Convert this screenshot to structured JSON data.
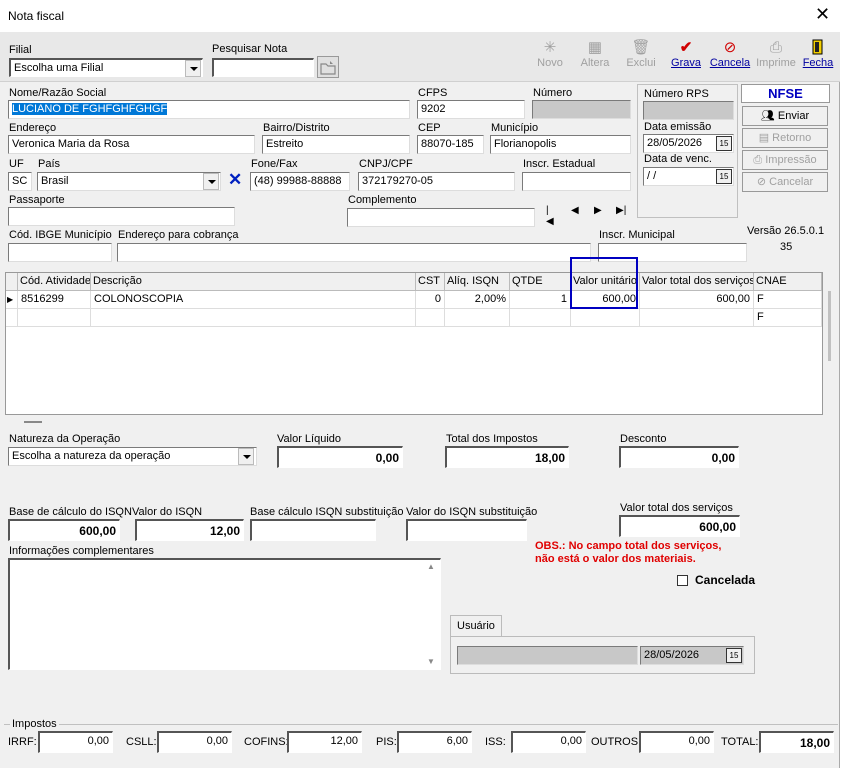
{
  "window": {
    "title": "Nota fiscal",
    "close": "✕"
  },
  "toolbar": {
    "filial_label": "Filial",
    "filial_value": "Escolha uma Filial",
    "pesquisar_label": "Pesquisar Nota",
    "pesquisar_value": "",
    "buttons": [
      {
        "label": "Novo",
        "icon": "new-icon",
        "enabled": false
      },
      {
        "label": "Altera",
        "icon": "edit-icon",
        "enabled": false
      },
      {
        "label": "Exclui",
        "icon": "trash-icon",
        "enabled": false
      },
      {
        "label": "Grava",
        "icon": "check-icon",
        "enabled": true
      },
      {
        "label": "Cancela",
        "icon": "cancel-icon",
        "enabled": true
      },
      {
        "label": "Imprime",
        "icon": "printer-icon",
        "enabled": false
      },
      {
        "label": "Fecha",
        "icon": "exit-door-icon",
        "enabled": true
      }
    ]
  },
  "form": {
    "nome_label": "Nome/Razão Social",
    "nome_value": "LUCIANO DE FGHFGHFGHGF",
    "cfps_label": "CFPS",
    "cfps_value": "9202",
    "numero_label": "Número",
    "numero_value": "",
    "endereco_label": "Endereço",
    "endereco_value": "Veronica Maria da Rosa",
    "bairro_label": "Bairro/Distrito",
    "bairro_value": "Estreito",
    "cep_label": "CEP",
    "cep_value": "88070-185",
    "municipio_label": "Município",
    "municipio_value": "Florianopolis",
    "uf_label": "UF",
    "uf_value": "SC",
    "pais_label": "País",
    "pais_value": "Brasil",
    "fone_label": "Fone/Fax",
    "fone_value": "(48) 99988-88888",
    "cnpj_label": "CNPJ/CPF",
    "cnpj_value": "372179270-05",
    "inscr_est_label": "Inscr. Estadual",
    "inscr_est_value": "",
    "passaporte_label": "Passaporte",
    "passaporte_value": "",
    "complemento_label": "Complemento",
    "complemento_value": "",
    "ibge_label": "Cód. IBGE Município",
    "ibge_value": "",
    "cobranca_label": "Endereço para cobrança",
    "cobranca_value": "",
    "inscr_mun_label": "Inscr. Municipal",
    "inscr_mun_value": "",
    "versao": "Versão 26.5.0.1",
    "versao_sub": "35"
  },
  "rps": {
    "numero_rps_label": "Número RPS",
    "numero_rps_value": "",
    "data_emissao_label": "Data emissão",
    "data_emissao_value": "28/05/2026",
    "data_venc_label": "Data de venc.",
    "data_venc_value": " /  /"
  },
  "nfse": {
    "title": "NFSE",
    "buttons": [
      {
        "label": "Enviar",
        "enabled": true
      },
      {
        "label": "Retorno",
        "enabled": false
      },
      {
        "label": "Impressão",
        "enabled": false
      },
      {
        "label": "Cancelar",
        "enabled": false
      }
    ]
  },
  "grid": {
    "headers": [
      "Cód. Atividade",
      "Descrição",
      "CST",
      "Alíq. ISQN",
      "QTDE",
      "Valor unitário",
      "Valor total dos serviços",
      "CNAE"
    ],
    "rows": [
      [
        "8516299",
        "COLONOSCOPIA",
        "0",
        "2,00%",
        "1",
        "600,00",
        "600,00",
        "F"
      ],
      [
        "",
        "",
        "",
        "",
        "",
        "",
        "",
        "F"
      ]
    ]
  },
  "totals": {
    "natureza_label": "Natureza da Operação",
    "natureza_value": "Escolha a natureza da operação",
    "valor_liquido_label": "Valor Líquido",
    "valor_liquido_value": "0,00",
    "total_impostos_label": "Total dos Impostos",
    "total_impostos_value": "18,00",
    "desconto_label": "Desconto",
    "desconto_value": "0,00",
    "base_isqn_label": "Base de cálculo do ISQN",
    "base_isqn_value": "600,00",
    "valor_isqn_label": "Valor do ISQN",
    "valor_isqn_value": "12,00",
    "base_sub_label": "Base cálculo  ISQN substituição",
    "base_sub_value": "",
    "valor_sub_label": "Valor do ISQN substituição",
    "valor_sub_value": "",
    "valor_total_label": "Valor total dos serviços",
    "valor_total_value": "600,00",
    "info_label": "Informações complementares",
    "obs_line1": "OBS.: No campo total dos serviços,",
    "obs_line2": "não está o valor dos materiais.",
    "cancelada_label": "Cancelada",
    "usuario_tab": "Usuário",
    "usuario_value": "",
    "usuario_date": "28/05/2026"
  },
  "impostos": {
    "title": "Impostos",
    "irrf_label": "IRRF:",
    "irrf": "0,00",
    "csll_label": "CSLL:",
    "csll": "0,00",
    "cofins_label": "COFINS:",
    "cofins": "12,00",
    "pis_label": "PIS:",
    "pis": "6,00",
    "iss_label": "ISS:",
    "iss": "0,00",
    "outros_label": "OUTROS:",
    "outros": "0,00",
    "total_label": "TOTAL:",
    "total": "18,00"
  }
}
